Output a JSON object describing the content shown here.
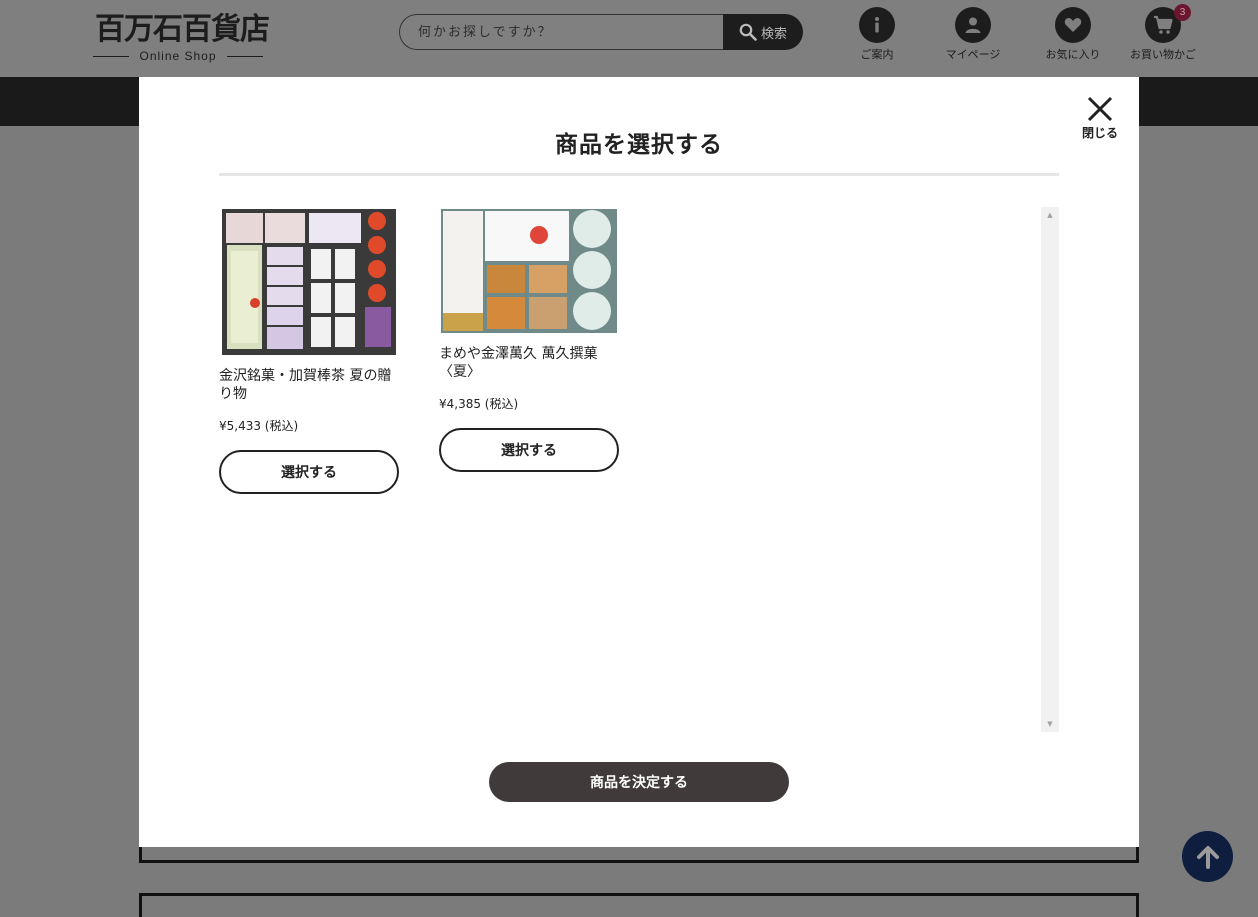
{
  "header": {
    "logo_main": "百万石百貨店",
    "logo_sub": "Online Shop",
    "search": {
      "placeholder": "何かお探しですか？",
      "button_label": "検索"
    },
    "nav": [
      {
        "label": "ご案内",
        "icon": "info-icon"
      },
      {
        "label": "マイページ",
        "icon": "user-icon"
      },
      {
        "label": "お気に入り",
        "icon": "heart-icon"
      },
      {
        "label": "お買い物かご",
        "icon": "cart-icon",
        "badge": "3"
      }
    ]
  },
  "modal": {
    "title": "商品を選択する",
    "close_label": "閉じる",
    "products": [
      {
        "name": "金沢銘菓・加賀棒茶 夏の贈り物",
        "price": "¥5,433 (税込)",
        "button_label": "選択する"
      },
      {
        "name": "まめや金澤萬久 萬久撰菓〈夏〉",
        "price": "¥4,385 (税込)",
        "button_label": "選択する"
      }
    ],
    "decide_label": "商品を決定する"
  },
  "colors": {
    "overlay": "#7b7b7b",
    "primary_button": "#403b3a",
    "badge": "#6b1730",
    "page_top": "#0f1d3f"
  }
}
